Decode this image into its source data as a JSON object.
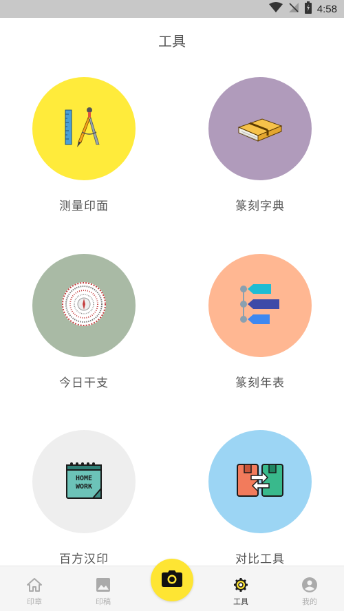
{
  "status_bar": {
    "time": "4:58",
    "icons": [
      "wifi-icon",
      "signal-icon",
      "battery-icon"
    ]
  },
  "page": {
    "title": "工具"
  },
  "tools": [
    {
      "label": "测量印面",
      "icon": "ruler-compass-icon",
      "color": "#ffeb3b"
    },
    {
      "label": "篆刻字典",
      "icon": "book-icon",
      "color": "#b09bbb"
    },
    {
      "label": "今日干支",
      "icon": "compass-dial-icon",
      "color": "#a9baa5"
    },
    {
      "label": "篆刻年表",
      "icon": "timeline-icon",
      "color": "#ffb792"
    },
    {
      "label": "百方汉印",
      "icon": "homework-notebook-icon",
      "color": "#eeeeee"
    },
    {
      "label": "对比工具",
      "icon": "compare-boxes-icon",
      "color": "#9cd5f4"
    }
  ],
  "bottom_nav": {
    "items": [
      {
        "label": "印章",
        "icon": "home-icon",
        "active": false
      },
      {
        "label": "印稿",
        "icon": "image-icon",
        "active": false
      },
      {
        "label": "工具",
        "icon": "gear-icon",
        "active": true
      },
      {
        "label": "我的",
        "icon": "account-circle-icon",
        "active": false
      }
    ],
    "camera_icon": "camera-icon",
    "accent": "#fee533"
  }
}
